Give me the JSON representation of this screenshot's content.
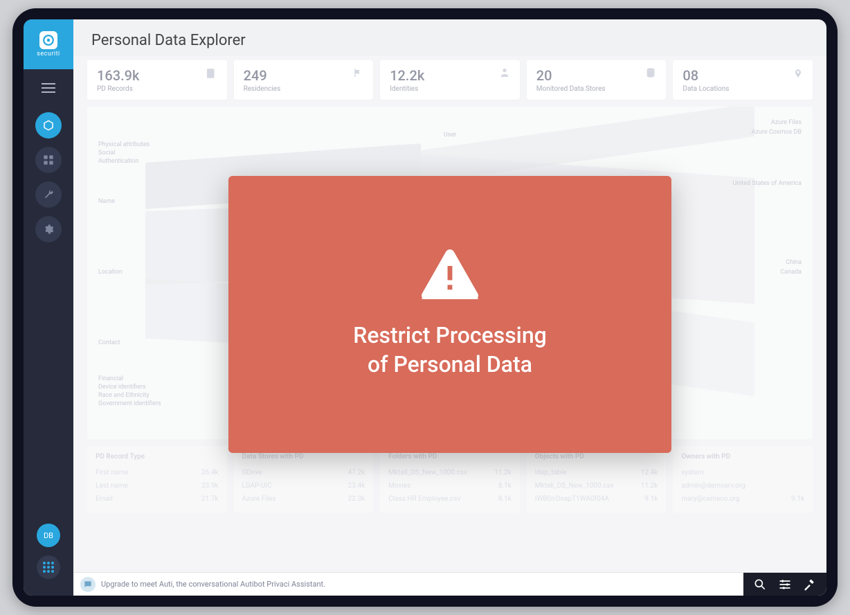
{
  "brand": {
    "name": "securiti"
  },
  "page": {
    "title": "Personal Data Explorer"
  },
  "sidebar": {
    "avatar_initials": "DB"
  },
  "metrics": [
    {
      "value": "163.9k",
      "label": "PD Records"
    },
    {
      "value": "249",
      "label": "Residencies"
    },
    {
      "value": "12.2k",
      "label": "Identities"
    },
    {
      "value": "20",
      "label": "Monitored Data Stores"
    },
    {
      "value": "08",
      "label": "Data Locations"
    }
  ],
  "sankey": {
    "left_categories": [
      "Physical attributes",
      "Social",
      "Authentication",
      "Name",
      "Location",
      "Contact",
      "Financial",
      "Device identifiers",
      "Race and Ethnicity",
      "Government identifiers"
    ],
    "mid_label": "User",
    "right_labels": [
      "Azure Files",
      "Azure Cosmos DB",
      "United States of America",
      "China",
      "Canada"
    ]
  },
  "tables": {
    "columns": [
      "PD Record Type",
      "Data Stores with PD",
      "Folders with PD",
      "Objects with PD",
      "Owners with PD"
    ],
    "col0": [
      {
        "label": "First name",
        "value": "26.4k"
      },
      {
        "label": "Last name",
        "value": "23.9k"
      },
      {
        "label": "Email",
        "value": "21.7k"
      }
    ],
    "col1": [
      {
        "label": "GDrive",
        "value": "47.2k"
      },
      {
        "label": "LDAP-UIC",
        "value": "23.4k"
      },
      {
        "label": "Azure Files",
        "value": "22.3k"
      }
    ],
    "col2": [
      {
        "label": "Mktall_DS_New_1000.csv",
        "value": "11.2k"
      },
      {
        "label": "Movies",
        "value": "8.1k"
      },
      {
        "label": "Class HR Employee.csv",
        "value": "8.1k"
      }
    ],
    "col3": [
      {
        "label": "ldap_table",
        "value": "12.4k"
      },
      {
        "label": "Mktall_DS_New_1000.csv",
        "value": "11.2k"
      },
      {
        "label": "IWB0rrDnapT1WA0f04A",
        "value": "9.1k"
      }
    ],
    "col4": [
      {
        "label": "system",
        "value": ""
      },
      {
        "label": "admin@demosrv.org",
        "value": ""
      },
      {
        "label": "mary@cemeco.org",
        "value": "9.1k"
      }
    ]
  },
  "modal": {
    "line1": "Restrict Processing",
    "line2": "of Personal Data"
  },
  "bottombar": {
    "message": "Upgrade to meet Auti, the conversational Autibot Privaci Assistant."
  }
}
